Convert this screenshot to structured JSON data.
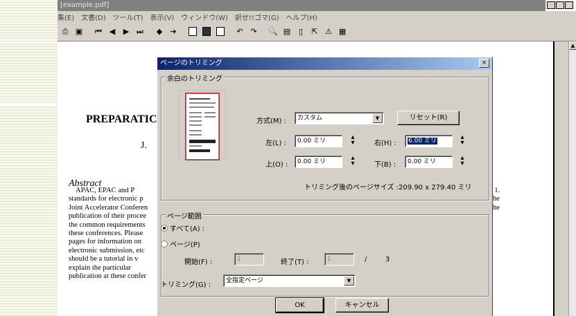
{
  "window": {
    "title": "[example.pdf]",
    "controls": [
      "_",
      "□",
      "×"
    ]
  },
  "menu": [
    "集(E)",
    "文書(D)",
    "ツール(T)",
    "表示(V)",
    "ウィンドウ(W)",
    "訳せ!!ゴマ(G)",
    "ヘルプ(H)"
  ],
  "toolbar_icons": [
    "print-icon",
    "fit-page-icon",
    "first-page-icon",
    "prev-page-icon",
    "next-page-icon",
    "last-page-icon",
    "back-icon",
    "forward-icon",
    "single-page-icon",
    "continuous-icon",
    "facing-icon",
    "rotate-left-icon",
    "rotate-right-icon",
    "find-icon",
    "bookmark-icon",
    "page-icon",
    "export-icon",
    "warning-icon",
    "app-logo-icon"
  ],
  "document": {
    "title": "PREPARATIC",
    "author": "J.",
    "abstract_heading": "Abstract",
    "body_lines": [
      "APAC, EPAC and P",
      "standards for electronic p",
      "Joint Accelerator Conferen",
      "publication of their procee",
      "the common requirements",
      "these conferences. Please",
      "pages for information on",
      "electronic submission, etc",
      "should be a tutorial in v",
      "explain the particular",
      "publication at these confer"
    ],
    "right_fragments": [
      ". 1.",
      "the",
      "the"
    ]
  },
  "dialog": {
    "title": "ページのトリミング",
    "close": "×",
    "margins_group": {
      "label": "余白のトリミング",
      "method_label": "方式(M) :",
      "method_value": "カスタム",
      "reset_button": "リセット(R)",
      "left_label": "左(L) :",
      "left_value": "0.00 ミリ",
      "right_label": "右(H) :",
      "right_value": "6.00 ミリ",
      "top_label": "上(O) :",
      "top_value": "0.00 ミリ",
      "bottom_label": "下(B) :",
      "bottom_value": "0.00 ミリ",
      "page_size_text": "トリミング後のページサイズ :209.90 x 279.40 ミリ"
    },
    "range_group": {
      "label": "ページ範囲",
      "all_option": "すべて(A) :",
      "pages_option": "ページ(P)",
      "start_label": "開始(F) :",
      "start_value": "1",
      "end_label": "終了(T) :",
      "end_value": "1",
      "separator": "/",
      "total_pages": "3",
      "trim_label": "トリミング(G) :",
      "trim_value": "全指定ページ"
    },
    "ok_button": "OK",
    "cancel_button": "キャンセル"
  }
}
